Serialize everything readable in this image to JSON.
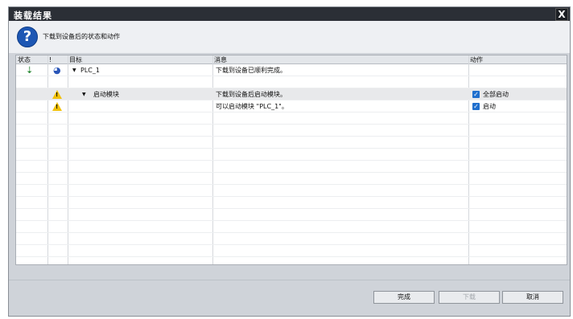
{
  "window": {
    "title": "装载结果",
    "close_label": "X"
  },
  "header": {
    "subtitle": "下载到设备后的状态和动作"
  },
  "columns": [
    "状态",
    "!",
    "目标",
    "消息",
    "动作"
  ],
  "rows": [
    {
      "target": "PLC_1",
      "message": "下载到设备已顺利完成。",
      "action": ""
    },
    {
      "target": "",
      "message": "",
      "action": ""
    },
    {
      "target": "启动模块",
      "message": "下载到设备后启动模块。",
      "action": "全部启动"
    },
    {
      "target": "",
      "message": "可以启动模块 \"PLC_1\"。",
      "action": "启动"
    }
  ],
  "buttons": {
    "finish": "完成",
    "load": "下载",
    "cancel": "取消"
  }
}
